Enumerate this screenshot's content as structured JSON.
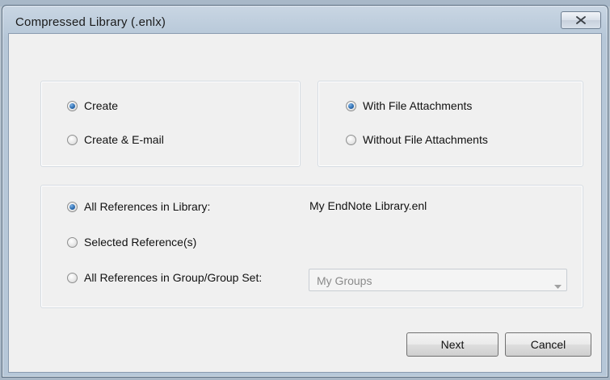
{
  "window": {
    "title": "Compressed Library (.enlx)"
  },
  "action_group": {
    "options": [
      {
        "label": "Create",
        "checked": true
      },
      {
        "label": "Create & E-mail",
        "checked": false
      }
    ]
  },
  "attachments_group": {
    "options": [
      {
        "label": "With File Attachments",
        "checked": true
      },
      {
        "label": "Without File Attachments",
        "checked": false
      }
    ]
  },
  "references_group": {
    "options": [
      {
        "label": "All References in Library:",
        "checked": true
      },
      {
        "label": "Selected Reference(s)",
        "checked": false
      },
      {
        "label": "All References in Group/Group Set:",
        "checked": false
      }
    ],
    "library_name": "My EndNote Library.enl",
    "group_select": {
      "value": "My Groups",
      "disabled": true
    }
  },
  "buttons": {
    "next_label": "Next",
    "cancel_label": "Cancel"
  },
  "icons": {
    "close": "close-icon",
    "dropdown": "chevron-down-icon"
  },
  "colors": {
    "radio_selected": "#2f6fb3",
    "window_frame": "#b6c7d8",
    "client_bg": "#f0f0f0"
  }
}
